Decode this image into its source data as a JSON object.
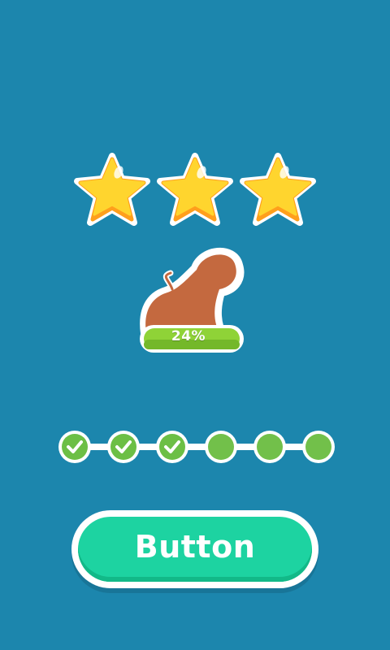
{
  "rating": {
    "stars_earned": 3,
    "stars_total": 3,
    "star_icon": "star-icon"
  },
  "reward": {
    "icon": "cannon-icon",
    "progress_text": "24%",
    "progress_value": 24
  },
  "level_progress": {
    "total": 6,
    "completed": 3,
    "completed_icon": "checkmark-icon"
  },
  "main_button": {
    "label": "Button"
  },
  "colors": {
    "background": "#1c86ad",
    "star": "#ffd52e",
    "cannon": "#c4693f",
    "progress_green": "#8fd337",
    "node_green": "#72c04a",
    "button": "#1dd3a1"
  }
}
